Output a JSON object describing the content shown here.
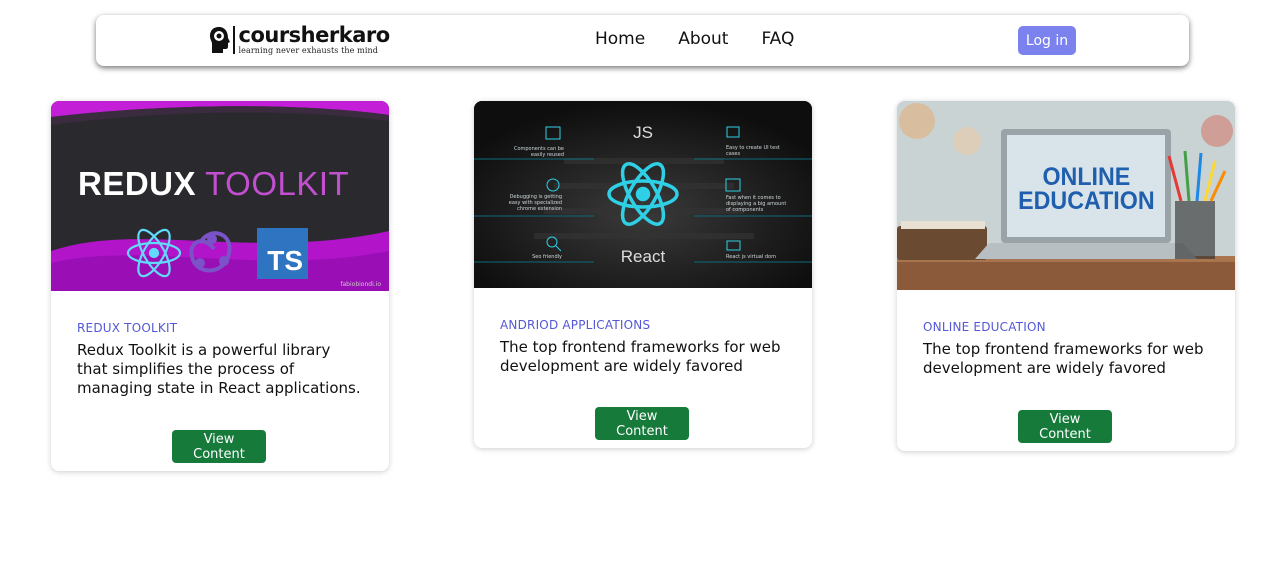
{
  "header": {
    "logo_name": "coursherkaro",
    "logo_tagline": "learning never exhausts the mind",
    "nav": [
      "Home",
      "About",
      "FAQ"
    ],
    "login_label": "Log in"
  },
  "cards": [
    {
      "category": "REDUX TOOLKIT",
      "description": "Redux Toolkit is a powerful library that simplifies the process of managing state in React applications.",
      "button": "View Content",
      "image": {
        "title_white": "REDUX",
        "title_purple": "TOOLKIT",
        "badge": "TS",
        "credit": "fabiobiondi.io"
      }
    },
    {
      "category": "ANDRIOD APPLICATIONS",
      "description": "The top frontend frameworks for web development are widely favored",
      "button": "View Content",
      "image": {
        "top_label": "JS",
        "bottom_label": "React",
        "notes": [
          "Components can be easily reused",
          "Debugging is getting easy with specialized chrome extension",
          "Seo friendly",
          "Easy to create UI test cases",
          "Fast when it comes to displaying a big amount of components",
          "React js virtual dom"
        ]
      }
    },
    {
      "category": "ONLINE EDUCATION",
      "description": "The top frontend frameworks for web development are widely favored",
      "button": "View Content",
      "image": {
        "line1": "ONLINE",
        "line2": "EDUCATION"
      }
    }
  ],
  "colors": {
    "accent": "#5458d6",
    "login_bg": "#7b82ee",
    "button_bg": "#157a3a"
  }
}
